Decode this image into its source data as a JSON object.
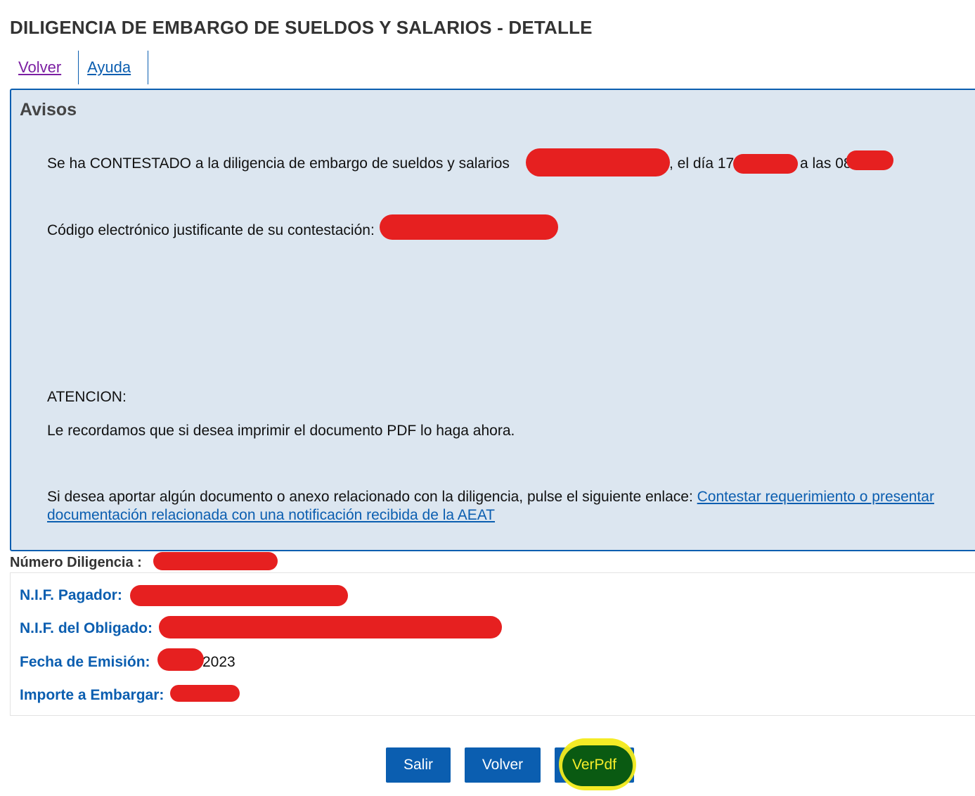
{
  "page": {
    "title": "DILIGENCIA DE EMBARGO DE SUELDOS Y SALARIOS - DETALLE"
  },
  "nav": {
    "volver": "Volver",
    "ayuda": "Ayuda"
  },
  "avisos": {
    "heading": "Avisos",
    "contestado_prefix": "Se ha CONTESTADO a la diligencia de embargo de sueldos y salarios",
    "contestado_dia": ", el día 17-0",
    "contestado_las": "a las 08.",
    "codigo_label": "Código electrónico justificante de su contestación:",
    "atencion": "ATENCION:",
    "recordatorio": "Le recordamos que si desea imprimir el documento PDF lo haga ahora.",
    "enlace_prefix": "Si desea aportar algún documento o anexo relacionado con la diligencia, pulse el siguiente enlace:",
    "enlace_text": "Contestar requerimiento o presentar documentación relacionada con una notificación recibida de la AEAT"
  },
  "numero_diligencia": {
    "label": "Número Diligencia :"
  },
  "detalle": {
    "nif_pagador": "N.I.F. Pagador:",
    "nif_obligado": "N.I.F. del Obligado:",
    "fecha_emision": "Fecha de Emisión:",
    "fecha_emision_value": "2023",
    "importe": "Importe a Embargar:"
  },
  "buttons": {
    "salir": "Salir",
    "volver": "Volver",
    "verpdf": "VerPdf"
  },
  "colors": {
    "primary": "#0b5eb0",
    "avisos_bg": "#dce6f0",
    "redaction": "#e62020",
    "highlight": "#f3ea1a"
  }
}
